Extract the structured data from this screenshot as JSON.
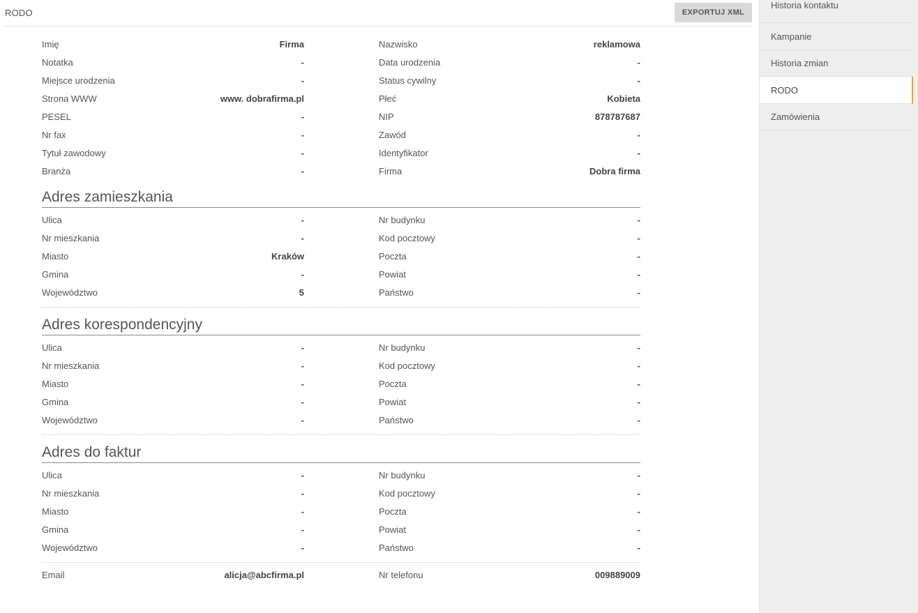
{
  "header": {
    "title": "RODO",
    "export_label": "EXPORTUJ XML"
  },
  "personal": {
    "left": [
      {
        "label": "Imię",
        "value": "Firma",
        "strong": true
      },
      {
        "label": "Notatka",
        "value": "-",
        "strong": true
      },
      {
        "label": "Miejsce urodzenia",
        "value": "-",
        "strong": true
      },
      {
        "label": "Strona WWW",
        "value": "www. dobrafirma.pl",
        "strong": true
      },
      {
        "label": "PESEL",
        "value": "-",
        "strong": true
      },
      {
        "label": "Nr fax",
        "value": "-",
        "strong": true
      },
      {
        "label": "Tytuł zawodowy",
        "value": "-",
        "strong": true
      },
      {
        "label": "Branża",
        "value": "-",
        "strong": true
      }
    ],
    "right": [
      {
        "label": "Nazwisko",
        "value": "reklamowa",
        "strong": true
      },
      {
        "label": "Data urodzenia",
        "value": "-",
        "strong": true
      },
      {
        "label": "Status cywilny",
        "value": "-",
        "strong": true
      },
      {
        "label": "Płeć",
        "value": "Kobieta",
        "strong": true
      },
      {
        "label": "NIP",
        "value": "878787687",
        "strong": true
      },
      {
        "label": "Zawód",
        "value": "-",
        "strong": true
      },
      {
        "label": "Identyfikator",
        "value": "-",
        "strong": true
      },
      {
        "label": "Firma",
        "value": "Dobra firma",
        "strong": true
      }
    ]
  },
  "sections": [
    {
      "title": "Adres zamieszkania",
      "left": [
        {
          "label": "Ulica",
          "value": "-"
        },
        {
          "label": "Nr mieszkania",
          "value": "-"
        },
        {
          "label": "Miasto",
          "value": "Kraków"
        },
        {
          "label": "Gmina",
          "value": "-"
        },
        {
          "label": "Województwo",
          "value": "5"
        }
      ],
      "right": [
        {
          "label": "Nr budynku",
          "value": "-"
        },
        {
          "label": "Kod pocztowy",
          "value": "-"
        },
        {
          "label": "Poczta",
          "value": "-"
        },
        {
          "label": "Powiat",
          "value": "-"
        },
        {
          "label": "Państwo",
          "value": "-"
        }
      ]
    },
    {
      "title": "Adres korespondencyjny",
      "left": [
        {
          "label": "Ulica",
          "value": "-"
        },
        {
          "label": "Nr mieszkania",
          "value": "-"
        },
        {
          "label": "Miasto",
          "value": "-"
        },
        {
          "label": "Gmina",
          "value": "-"
        },
        {
          "label": "Województwo",
          "value": "-"
        }
      ],
      "right": [
        {
          "label": "Nr budynku",
          "value": "-"
        },
        {
          "label": "Kod pocztowy",
          "value": "-"
        },
        {
          "label": "Poczta",
          "value": "-"
        },
        {
          "label": "Powiat",
          "value": "-"
        },
        {
          "label": "Państwo",
          "value": "-"
        }
      ]
    },
    {
      "title": "Adres do faktur",
      "left": [
        {
          "label": "Ulica",
          "value": "-"
        },
        {
          "label": "Nr mieszkania",
          "value": "-"
        },
        {
          "label": "Miasto",
          "value": "-"
        },
        {
          "label": "Gmina",
          "value": "-"
        },
        {
          "label": "Województwo",
          "value": "-"
        }
      ],
      "right": [
        {
          "label": "Nr budynku",
          "value": "-"
        },
        {
          "label": "Kod pocztowy",
          "value": "-"
        },
        {
          "label": "Poczta",
          "value": "-"
        },
        {
          "label": "Powiat",
          "value": "-"
        },
        {
          "label": "Państwo",
          "value": "-"
        }
      ]
    }
  ],
  "contact": {
    "email_label": "Email",
    "email_value": "alicja@abcfirma.pl",
    "phone_label": "Nr telefonu",
    "phone_value": "009889009"
  },
  "sidebar": {
    "items": [
      {
        "label": "Historia kontaktu",
        "active": false
      },
      {
        "label": "Kampanie",
        "active": false
      },
      {
        "label": "Historia zmian",
        "active": false
      },
      {
        "label": "RODO",
        "active": true
      },
      {
        "label": "Zamówienia",
        "active": false
      }
    ]
  },
  "colors": {
    "active_accent": "#f0a030",
    "sidebar_bg": "#eeeeee",
    "button_bg": "#d9d9d9"
  }
}
